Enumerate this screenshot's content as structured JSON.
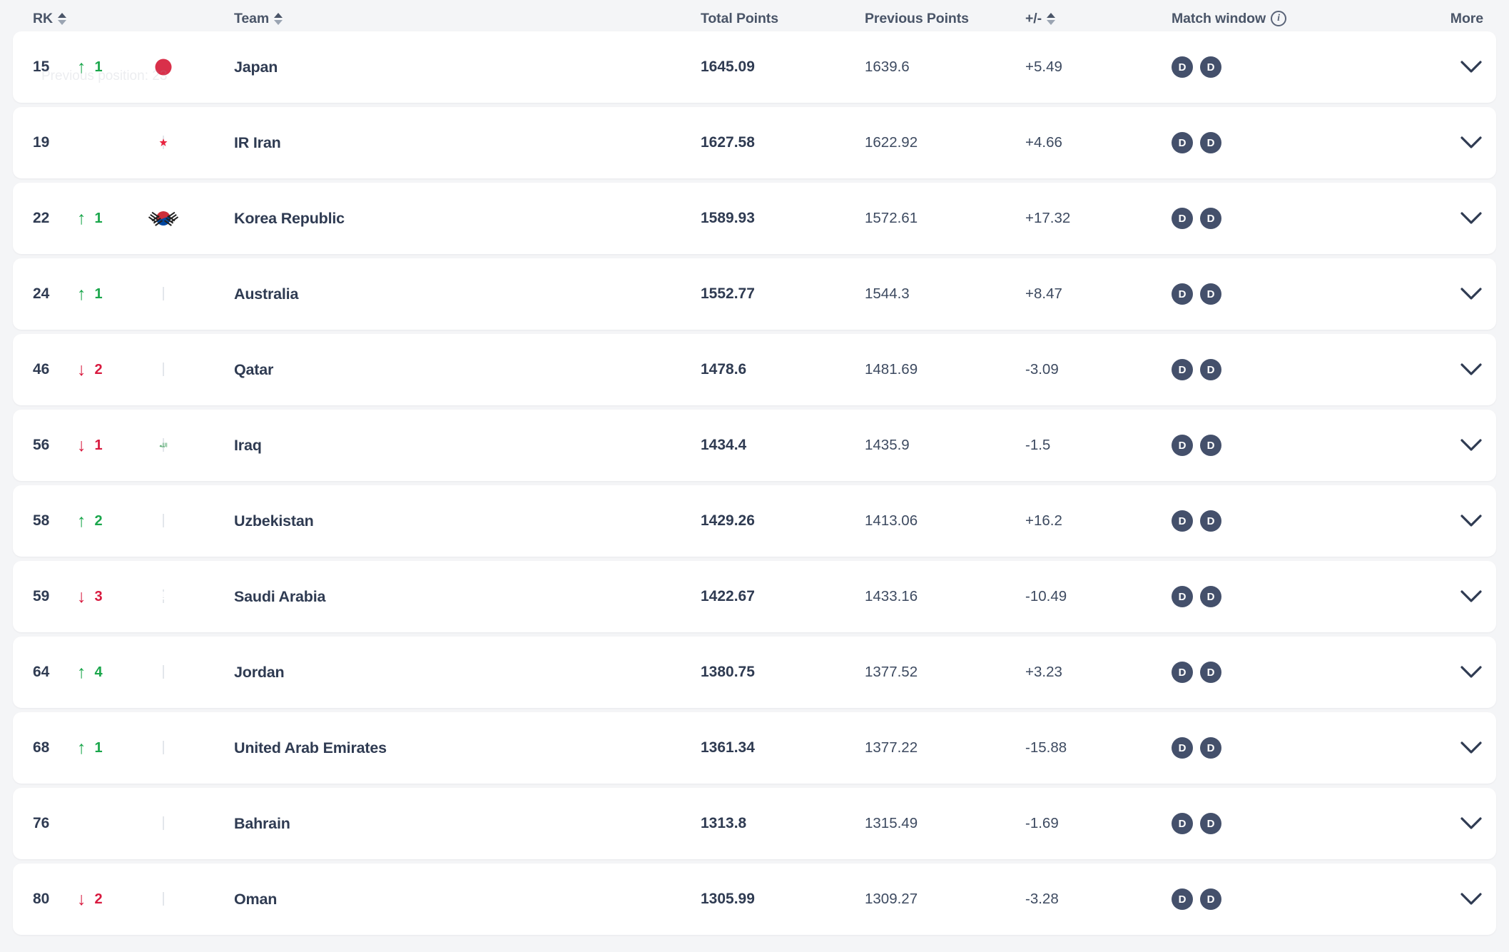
{
  "header": {
    "rk_label": "RK",
    "team_label": "Team",
    "total_points_label": "Total Points",
    "previous_points_label": "Previous Points",
    "diff_label": "+/-",
    "match_window_label": "Match window",
    "info_glyph": "i",
    "more_label": "More"
  },
  "tooltip": {
    "previous_position": "Previous position: 23"
  },
  "colors": {
    "up": "#1aa64b",
    "down": "#d81a3f",
    "neutral_dot": "#c7cdd8",
    "badge": "#44506b",
    "text": "#2f3b52",
    "page_background": "#f4f5f7",
    "row_background": "#ffffff"
  },
  "badge_label": "D",
  "rows": [
    {
      "rank": "15",
      "move_dir": "up",
      "move_value": "1",
      "team": "Japan",
      "flag": "japan",
      "total": "1645.09",
      "previous": "1639.6",
      "diff": "+5.49",
      "window": [
        "D",
        "D"
      ]
    },
    {
      "rank": "19",
      "move_dir": "none",
      "move_value": "",
      "team": "IR Iran",
      "flag": "iran",
      "total": "1627.58",
      "previous": "1622.92",
      "diff": "+4.66",
      "window": [
        "D",
        "D"
      ]
    },
    {
      "rank": "22",
      "move_dir": "up",
      "move_value": "1",
      "team": "Korea Republic",
      "flag": "korea",
      "total": "1589.93",
      "previous": "1572.61",
      "diff": "+17.32",
      "window": [
        "D",
        "D"
      ]
    },
    {
      "rank": "24",
      "move_dir": "up",
      "move_value": "1",
      "team": "Australia",
      "flag": "australia",
      "total": "1552.77",
      "previous": "1544.3",
      "diff": "+8.47",
      "window": [
        "D",
        "D"
      ]
    },
    {
      "rank": "46",
      "move_dir": "down",
      "move_value": "2",
      "team": "Qatar",
      "flag": "qatar",
      "total": "1478.6",
      "previous": "1481.69",
      "diff": "-3.09",
      "window": [
        "D",
        "D"
      ]
    },
    {
      "rank": "56",
      "move_dir": "down",
      "move_value": "1",
      "team": "Iraq",
      "flag": "iraq",
      "total": "1434.4",
      "previous": "1435.9",
      "diff": "-1.5",
      "window": [
        "D",
        "D"
      ]
    },
    {
      "rank": "58",
      "move_dir": "up",
      "move_value": "2",
      "team": "Uzbekistan",
      "flag": "uzbek",
      "total": "1429.26",
      "previous": "1413.06",
      "diff": "+16.2",
      "window": [
        "D",
        "D"
      ]
    },
    {
      "rank": "59",
      "move_dir": "down",
      "move_value": "3",
      "team": "Saudi Arabia",
      "flag": "saudi",
      "total": "1422.67",
      "previous": "1433.16",
      "diff": "-10.49",
      "window": [
        "D",
        "D"
      ]
    },
    {
      "rank": "64",
      "move_dir": "up",
      "move_value": "4",
      "team": "Jordan",
      "flag": "jordan",
      "total": "1380.75",
      "previous": "1377.52",
      "diff": "+3.23",
      "window": [
        "D",
        "D"
      ]
    },
    {
      "rank": "68",
      "move_dir": "up",
      "move_value": "1",
      "team": "United Arab Emirates",
      "flag": "uae",
      "total": "1361.34",
      "previous": "1377.22",
      "diff": "-15.88",
      "window": [
        "D",
        "D"
      ]
    },
    {
      "rank": "76",
      "move_dir": "none",
      "move_value": "",
      "team": "Bahrain",
      "flag": "bahrain",
      "total": "1313.8",
      "previous": "1315.49",
      "diff": "-1.69",
      "window": [
        "D",
        "D"
      ]
    },
    {
      "rank": "80",
      "move_dir": "down",
      "move_value": "2",
      "team": "Oman",
      "flag": "oman",
      "total": "1305.99",
      "previous": "1309.27",
      "diff": "-3.28",
      "window": [
        "D",
        "D"
      ]
    }
  ]
}
